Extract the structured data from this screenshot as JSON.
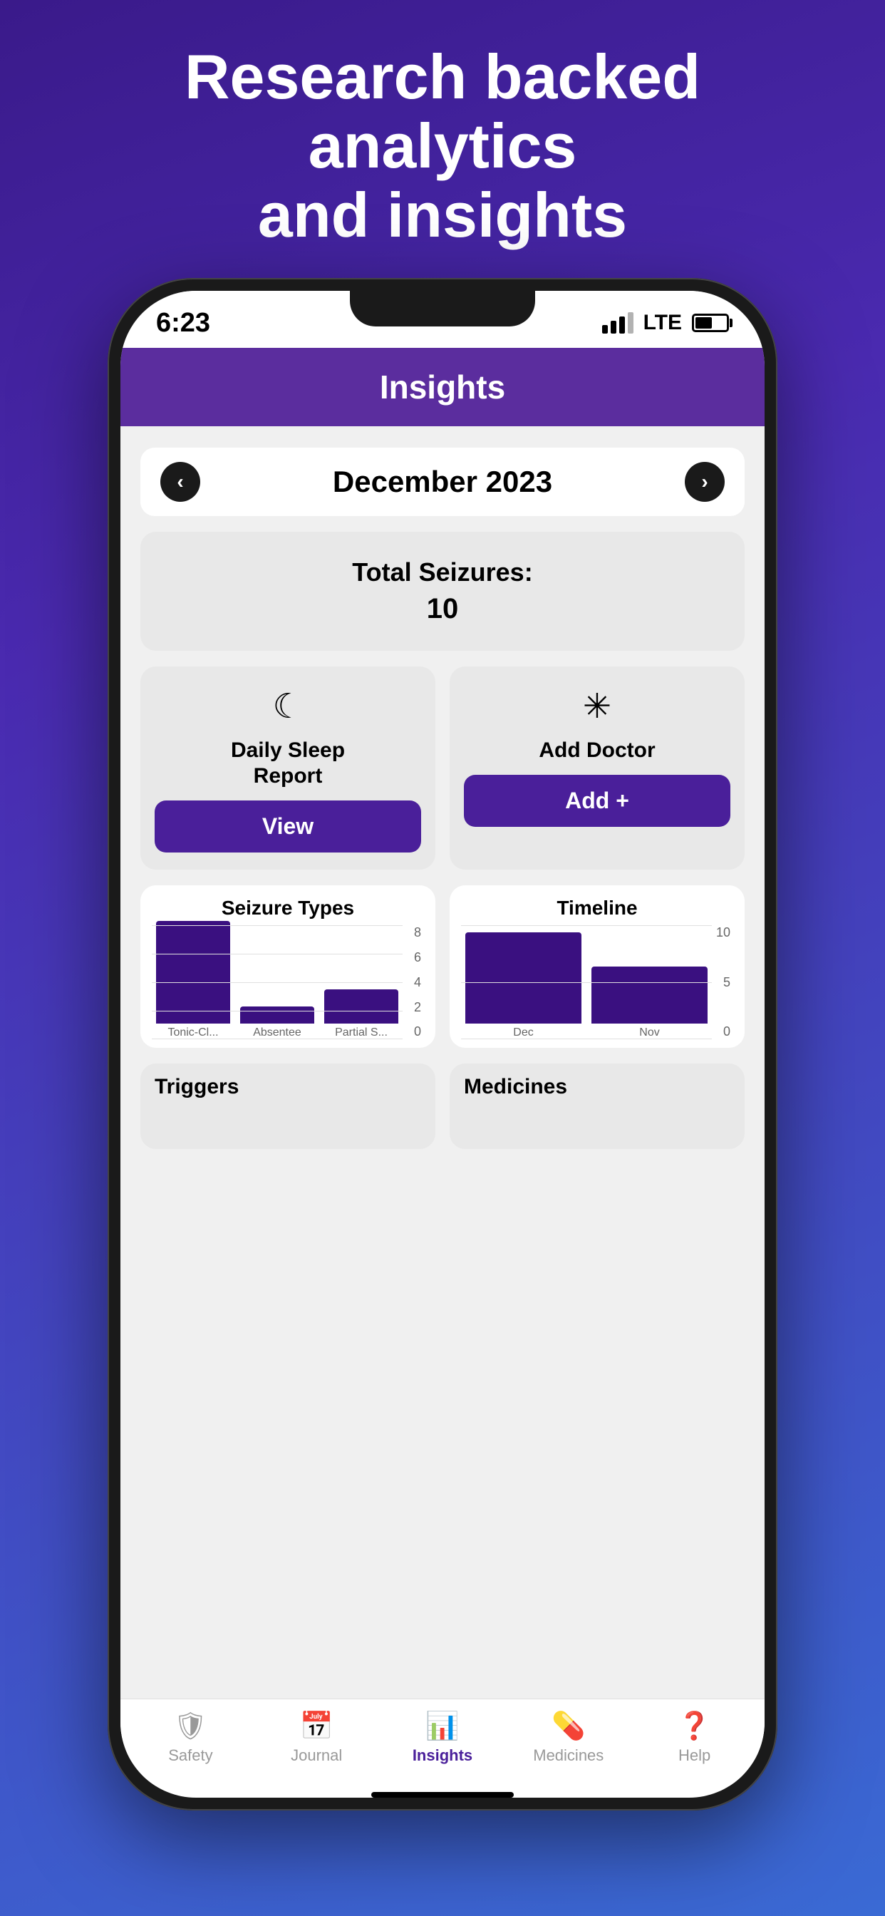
{
  "page": {
    "header_line1": "Research backed analytics",
    "header_line2": "and insights"
  },
  "status_bar": {
    "time": "6:23",
    "carrier": "LTE"
  },
  "app_header": {
    "title": "Insights"
  },
  "month_nav": {
    "month": "December 2023",
    "prev_arrow": "‹",
    "next_arrow": "›"
  },
  "total_seizures": {
    "label": "Total Seizures:",
    "count": "10"
  },
  "sleep_card": {
    "icon": "☾",
    "label": "Daily Sleep\nReport",
    "button": "View"
  },
  "doctor_card": {
    "icon": "✳",
    "label": "Add Doctor",
    "button": "Add +"
  },
  "seizure_types_chart": {
    "title": "Seizure Types",
    "y_labels": [
      "8",
      "6",
      "4",
      "2",
      "0"
    ],
    "bars": [
      {
        "label": "Tonic-Cl...",
        "value": 7.2,
        "max": 8
      },
      {
        "label": "Absentee",
        "value": 1.2,
        "max": 8
      },
      {
        "label": "Partial S...",
        "value": 2.4,
        "max": 8
      }
    ]
  },
  "timeline_chart": {
    "title": "Timeline",
    "y_labels": [
      "10",
      "5",
      "0"
    ],
    "bars": [
      {
        "label": "Dec",
        "value": 8,
        "max": 10
      },
      {
        "label": "Nov",
        "value": 5,
        "max": 10
      }
    ]
  },
  "triggers_section": {
    "title": "Triggers"
  },
  "medicines_section": {
    "title": "Medicines"
  },
  "bottom_nav": {
    "items": [
      {
        "label": "Safety",
        "icon": "🛡",
        "active": false
      },
      {
        "label": "Journal",
        "icon": "📅",
        "active": false
      },
      {
        "label": "Insights",
        "icon": "📊",
        "active": true
      },
      {
        "label": "Medicines",
        "icon": "💊",
        "active": false
      },
      {
        "label": "Help",
        "icon": "❓",
        "active": false
      }
    ]
  }
}
